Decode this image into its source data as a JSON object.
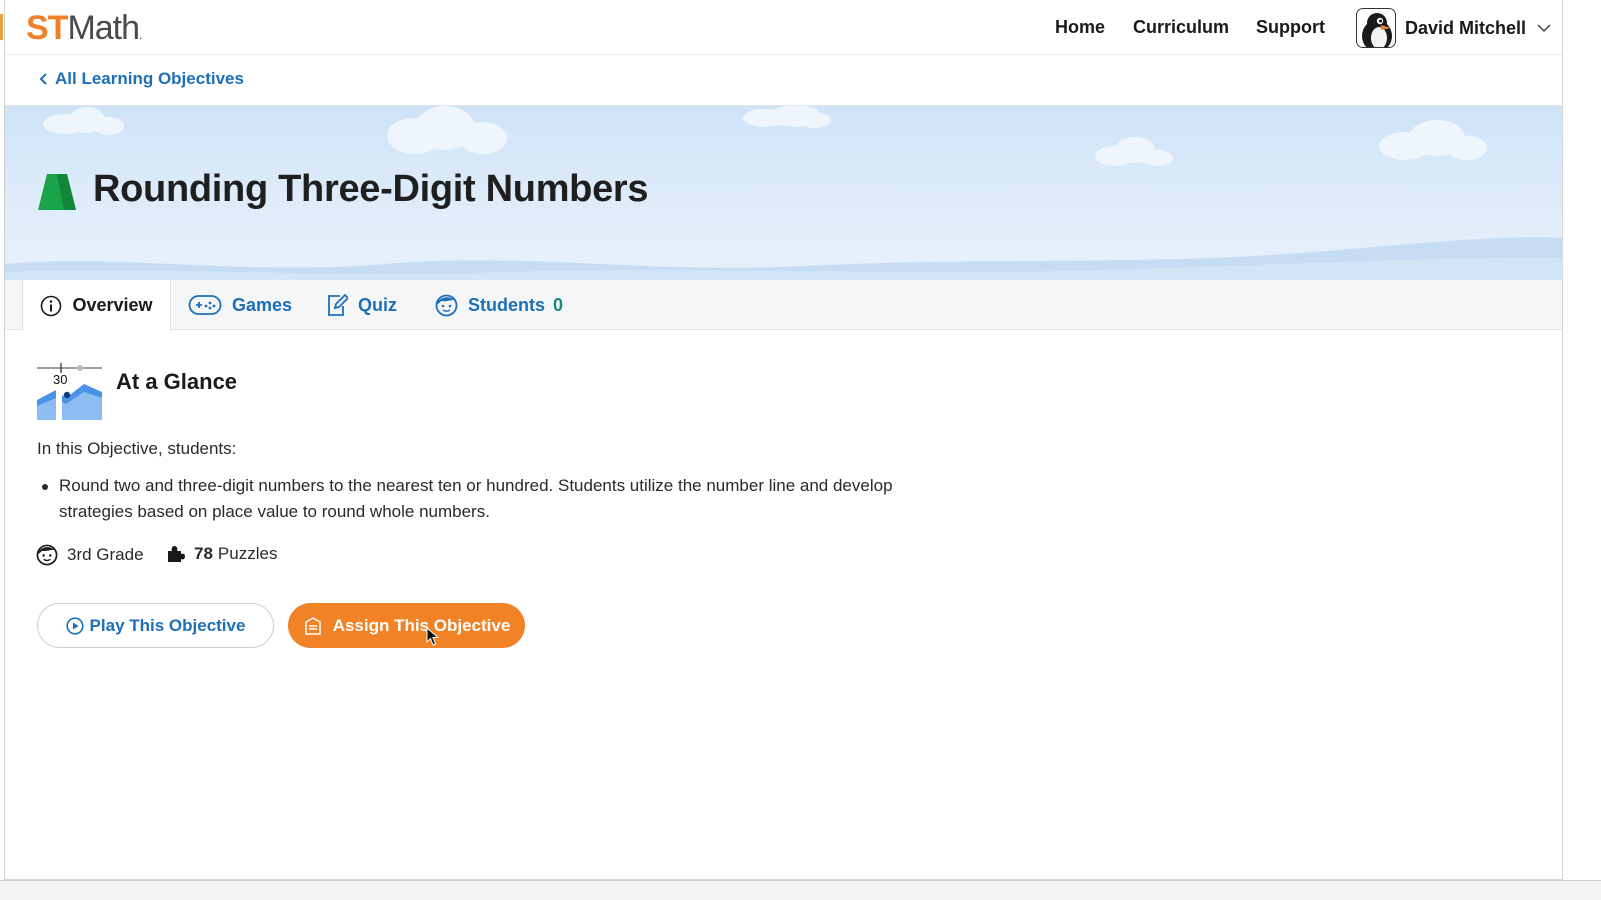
{
  "header": {
    "logo": {
      "st": "ST",
      "math": "Math",
      "mark": "."
    },
    "nav": [
      "Home",
      "Curriculum",
      "Support"
    ],
    "user_name": "David Mitchell"
  },
  "breadcrumb": {
    "label": "All Learning Objectives"
  },
  "objective": {
    "title": "Rounding Three-Digit Numbers",
    "icon": "green-trapezoid-icon"
  },
  "tabs": [
    {
      "label": "Overview",
      "icon": "info-icon",
      "active": true
    },
    {
      "label": "Games",
      "icon": "gamepad-icon"
    },
    {
      "label": "Quiz",
      "icon": "quiz-edit-icon"
    },
    {
      "label": "Students",
      "icon": "student-face-icon",
      "count": "0"
    }
  ],
  "glance": {
    "title": "At a Glance",
    "icon_number": "30",
    "intro": "In this Objective, students:",
    "bullets": [
      "Round two and three-digit numbers to the nearest ten or hundred. Students utilize the number line and develop strategies based on place value to round whole numbers."
    ],
    "grade": "3rd Grade",
    "puzzles_count": "78",
    "puzzles_label": "Puzzles"
  },
  "actions": {
    "play_label": "Play This Objective",
    "assign_label": "Assign This Objective"
  },
  "colors": {
    "brand_orange": "#f28226",
    "link_blue": "#1d6fb8",
    "student_count_teal": "#138a7a",
    "objective_green": "#1aa44a"
  }
}
